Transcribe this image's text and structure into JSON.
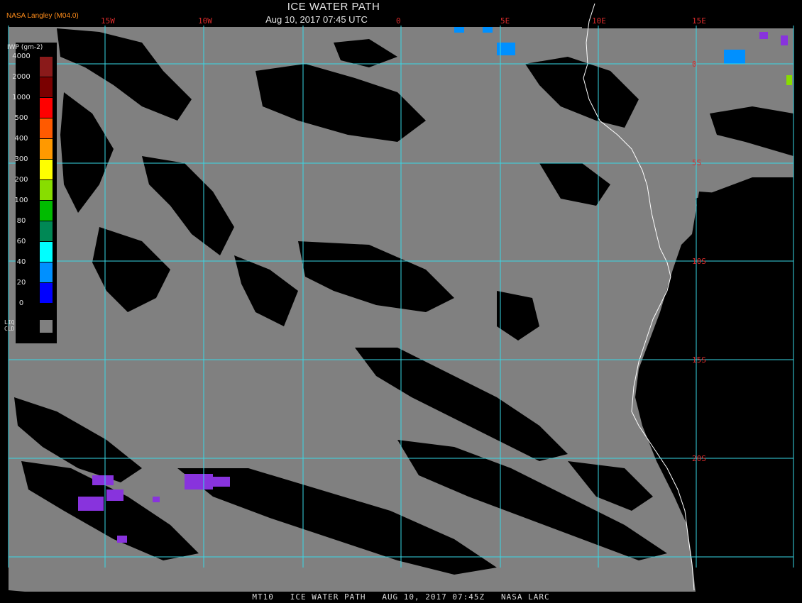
{
  "header": {
    "title": "ICE WATER PATH",
    "datetime": "Aug 10, 2017 07:45 UTC",
    "source": "NASA Langley (M04.0)"
  },
  "footer": "MT10   ICE WATER PATH   AUG 10, 2017 07:45Z   NASA LARC",
  "map": {
    "longitude_labels": [
      "15W",
      "10W",
      "0",
      "5E",
      "10E",
      "15E"
    ],
    "latitude_labels": [
      "0",
      "5S",
      "10S",
      "15S",
      "20S"
    ],
    "colors": {
      "land": "#000000",
      "ocean_liquid_cloud": "#808080",
      "grid": "#39d8e6",
      "coast": "#ffffff",
      "label": "#d92b2b"
    }
  },
  "legend": {
    "title": "IWP (gm-2)",
    "levels": [
      {
        "value": "4000",
        "color": "#8a1a1a"
      },
      {
        "value": "2000",
        "color": "#7a0000"
      },
      {
        "value": "1000",
        "color": "#ff0000"
      },
      {
        "value": "500",
        "color": "#ff5a00"
      },
      {
        "value": "400",
        "color": "#ff9900"
      },
      {
        "value": "300",
        "color": "#ffff00"
      },
      {
        "value": "200",
        "color": "#88dd00"
      },
      {
        "value": "100",
        "color": "#00bb00"
      },
      {
        "value": "80",
        "color": "#008855"
      },
      {
        "value": "60",
        "color": "#00ffff"
      },
      {
        "value": "40",
        "color": "#0090ff"
      },
      {
        "value": "20",
        "color": "#0000ff"
      },
      {
        "value": "0",
        "color": "#8833dd"
      }
    ],
    "liq_label": "LIQ",
    "cld_label": "CLD"
  }
}
